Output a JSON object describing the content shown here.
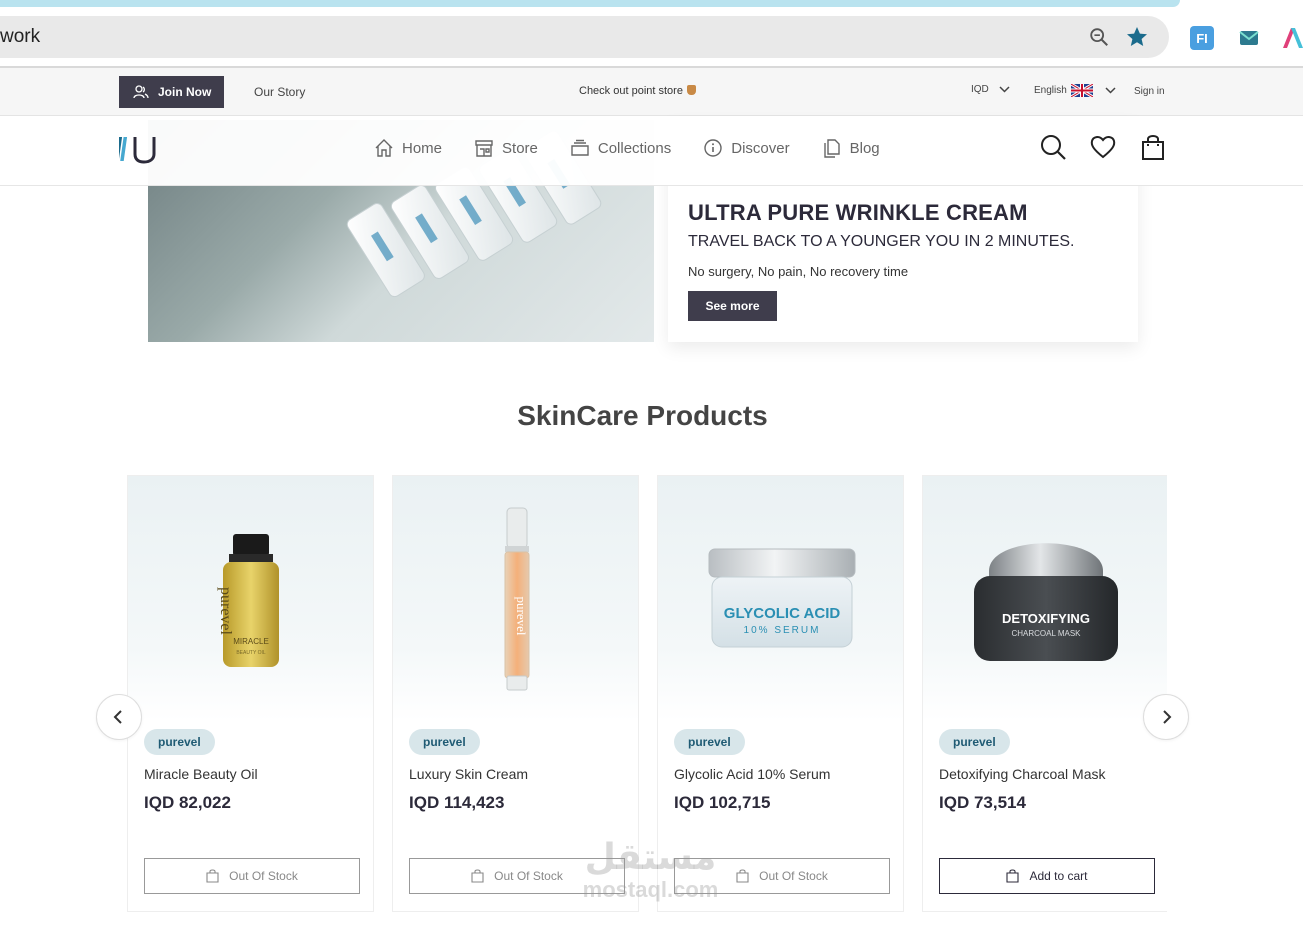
{
  "browser": {
    "url_fragment": "work"
  },
  "topbar": {
    "join_label": "Join Now",
    "our_story": "Our Story",
    "promo_text": "Check out point store",
    "currency": "IQD",
    "language": "English",
    "signin": "Sign in"
  },
  "nav": {
    "items": [
      {
        "label": "Home",
        "icon": "home-icon"
      },
      {
        "label": "Store",
        "icon": "store-icon"
      },
      {
        "label": "Collections",
        "icon": "collections-icon"
      },
      {
        "label": "Discover",
        "icon": "info-icon"
      },
      {
        "label": "Blog",
        "icon": "blog-icon"
      }
    ]
  },
  "hero": {
    "title": "ULTRA PURE WRINKLE CREAM",
    "subtitle": "TRAVEL BACK TO A YOUNGER YOU IN 2 MINUTES.",
    "description": "No surgery, No pain, No recovery time",
    "button": "See more"
  },
  "section": {
    "title": "SkinCare Products"
  },
  "products": [
    {
      "brand": "purevel",
      "name": "Miracle Beauty Oil",
      "price": "IQD 82,022",
      "button": "Out Of Stock",
      "in_stock": false
    },
    {
      "brand": "purevel",
      "name": "Luxury Skin Cream",
      "price": "IQD 114,423",
      "button": "Out Of Stock",
      "in_stock": false
    },
    {
      "brand": "purevel",
      "name": "Glycolic Acid 10% Serum",
      "price": "IQD 102,715",
      "button": "Out Of Stock",
      "in_stock": false
    },
    {
      "brand": "purevel",
      "name": "Detoxifying Charcoal Mask",
      "price": "IQD 73,514",
      "button": "Add to cart",
      "in_stock": true
    }
  ],
  "product_labels": {
    "oil_line1": "purevel",
    "oil_line2": "MIRACLE",
    "oil_line3": "BEAUTY OIL",
    "serum_line1": "GLYCOLIC ACID",
    "serum_line2": "10% SERUM",
    "mask_line1": "DETOXIFYING",
    "mask_line2": "CHARCOAL MASK"
  },
  "watermark": {
    "arabic": "مستقل",
    "latin": "mostaql.com"
  },
  "colors": {
    "dark_button": "#3f3d4c",
    "pill_bg": "#d8e6ea",
    "pill_text": "#1f5b74",
    "star": "#1b6b8c"
  }
}
